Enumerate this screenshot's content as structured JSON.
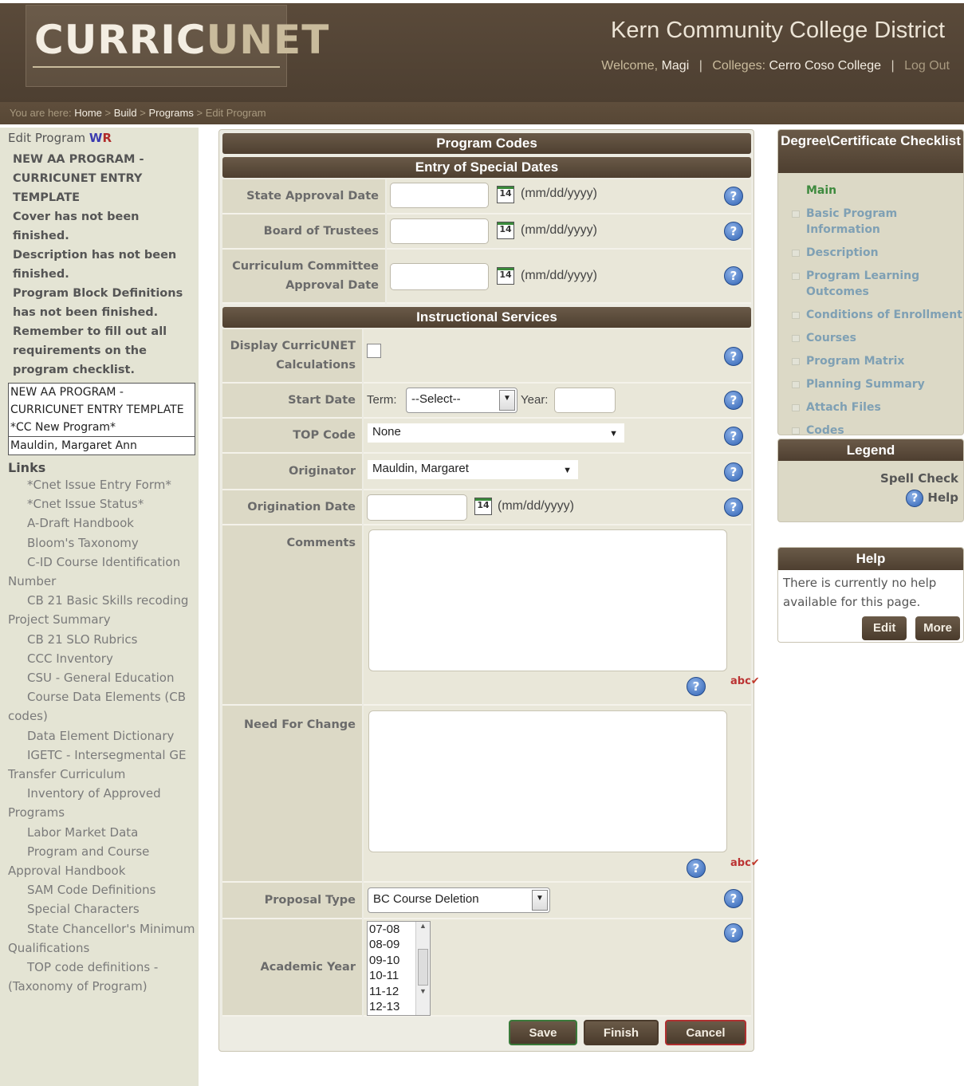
{
  "header": {
    "logo_part1": "CURRIC",
    "logo_part2": "UNET",
    "site_title": "Kern Community College District",
    "welcome_label": "Welcome,",
    "user_name": "Magi",
    "colleges_label": "Colleges:",
    "college_name": "Cerro Coso College",
    "logout": "Log Out",
    "separator": "|"
  },
  "breadcrumb": {
    "prefix": "You are here:",
    "items": [
      "Home",
      "Build",
      "Programs"
    ],
    "current": "Edit Program",
    "sep": ">"
  },
  "left": {
    "title": "Edit Program",
    "wr_icon_w": "W",
    "wr_icon_r": "R",
    "warnings": [
      "NEW AA PROGRAM - CURRICUNET ENTRY TEMPLATE",
      "Cover has not been finished.",
      "Description has not been finished.",
      "Program Block Definitions has not been finished.",
      "Remember to fill out all requirements on the program checklist."
    ],
    "program_name": "NEW AA PROGRAM - CURRICUNET ENTRY TEMPLATE *CC New Program*",
    "originator_name": "Mauldin, Margaret Ann",
    "links_heading": "Links",
    "links": [
      "*Cnet Issue Entry Form*",
      "*Cnet Issue Status*",
      "A-Draft Handbook",
      "Bloom's Taxonomy",
      "C-ID Course Identification Number",
      "CB 21 Basic Skills recoding Project Summary",
      "CB 21 SLO Rubrics",
      "CCC Inventory",
      "CSU - General Education",
      "Course Data Elements (CB codes)",
      "Data Element Dictionary",
      "IGETC - Intersegmental GE Transfer Curriculum",
      "Inventory of Approved Programs",
      "Labor Market Data",
      "Program and Course Approval Handbook",
      "SAM Code Definitions",
      "Special Characters",
      "State Chancellor's Minimum Qualifications",
      "TOP code definitions -(Taxonomy of Program)"
    ]
  },
  "form": {
    "program_codes_title": "Program Codes",
    "special_dates_title": "Entry of Special Dates",
    "state_approval_label": "State Approval Date",
    "board_trustees_label": "Board of Trustees",
    "curriculum_committee_label": "Curriculum Committee Approval Date",
    "date_format": "(mm/dd/yyyy)",
    "calendar_day": "14",
    "instructional_title": "Instructional Services",
    "display_calc_label": "Display CurricUNET Calculations",
    "start_date_label": "Start Date",
    "term_label": "Term:",
    "term_value": "--Select--",
    "year_label": "Year:",
    "top_code_label": "TOP Code",
    "top_code_value": "None",
    "originator_label": "Originator",
    "originator_value": "Mauldin, Margaret",
    "origination_date_label": "Origination Date",
    "comments_label": "Comments",
    "need_change_label": "Need For Change",
    "proposal_type_label": "Proposal Type",
    "proposal_type_value": "BC Course Deletion",
    "academic_year_label": "Academic Year",
    "academic_years": [
      "07-08",
      "08-09",
      "09-10",
      "10-11",
      "11-12",
      "12-13"
    ],
    "help_glyph": "?",
    "save": "Save",
    "finish": "Finish",
    "cancel": "Cancel"
  },
  "checklist": {
    "title": "Degree\\Certificate Checklist",
    "main": "Main",
    "items": [
      "Basic Program Information",
      "Description",
      "Program Learning Outcomes",
      "Conditions of Enrollment",
      "Courses",
      "Program Matrix",
      "Planning Summary",
      "Attach Files",
      "Codes"
    ]
  },
  "legend": {
    "title": "Legend",
    "spell_check": "Spell Check",
    "help": "Help"
  },
  "help_panel": {
    "title": "Help",
    "text": "There is currently no help available for this page.",
    "edit": "Edit",
    "more": "More"
  },
  "colors": {
    "header_brown": "#5a4a3a",
    "panel_tan": "#dcd9c6",
    "link_blue": "#7fa0b4",
    "main_green": "#3e8a3e",
    "help_blue": "#2f62b4"
  },
  "icons": [
    "calendar-icon",
    "help-icon",
    "spell-check-icon",
    "checkbox-icon",
    "dropdown-arrow-icon"
  ]
}
